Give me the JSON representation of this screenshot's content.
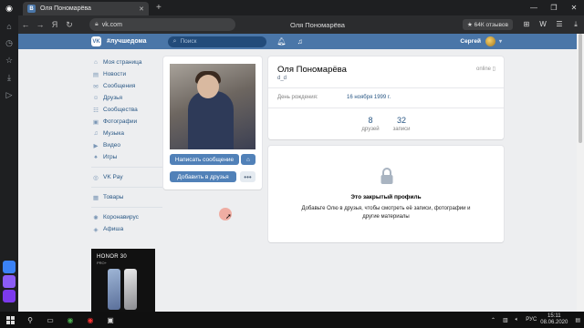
{
  "browser": {
    "tab_title": "Оля Пономарёва",
    "tab_close": "✕",
    "new_tab": "+",
    "url": "vk.com",
    "page_title": "Оля Пономарёва",
    "reviews_badge": "★ 64К отзывов",
    "window_controls": [
      "—",
      "❐",
      "✕"
    ]
  },
  "vk_header": {
    "logo": "VK",
    "hashtag": "#лучшедома",
    "search_placeholder": "Поиск",
    "user_name": "Сергей"
  },
  "left_menu": {
    "items": [
      {
        "icon": "home-icon",
        "label": "Моя страница"
      },
      {
        "icon": "news-icon",
        "label": "Новости"
      },
      {
        "icon": "messages-icon",
        "label": "Сообщения"
      },
      {
        "icon": "friends-icon",
        "label": "Друзья"
      },
      {
        "icon": "groups-icon",
        "label": "Сообщества"
      },
      {
        "icon": "photos-icon",
        "label": "Фотографии"
      },
      {
        "icon": "music-icon",
        "label": "Музыка"
      },
      {
        "icon": "video-icon",
        "label": "Видео"
      },
      {
        "icon": "games-icon",
        "label": "Игры"
      }
    ],
    "group2": [
      {
        "icon": "vkpay-icon",
        "label": "VK Pay"
      }
    ],
    "group3": [
      {
        "icon": "goods-icon",
        "label": "Товары"
      }
    ],
    "group4": [
      {
        "icon": "corona-icon",
        "label": "Коронавирус"
      },
      {
        "icon": "poster-icon",
        "label": "Афиша"
      }
    ]
  },
  "ad": {
    "title": "HONOR 30",
    "subtitle": "PRO+"
  },
  "profile": {
    "write_message": "Написать сообщение",
    "add_friend": "Добавить в друзья",
    "more": "•••",
    "name": "Оля Пономарёва",
    "status": "d_d",
    "online": "online ▯",
    "birthday_label": "День рождения:",
    "birthday_value": "16 ноября 1999 г.",
    "friends_count": "8",
    "friends_label": "друзей",
    "posts_count": "32",
    "posts_label": "записи",
    "private_title": "Это закрытый профиль",
    "private_desc": "Добавьте Олю в друзья, чтобы смотреть её записи, фотографии и другие материалы"
  },
  "taskbar": {
    "lang": "РУС",
    "time": "15:11",
    "date": "08.06.2020"
  }
}
